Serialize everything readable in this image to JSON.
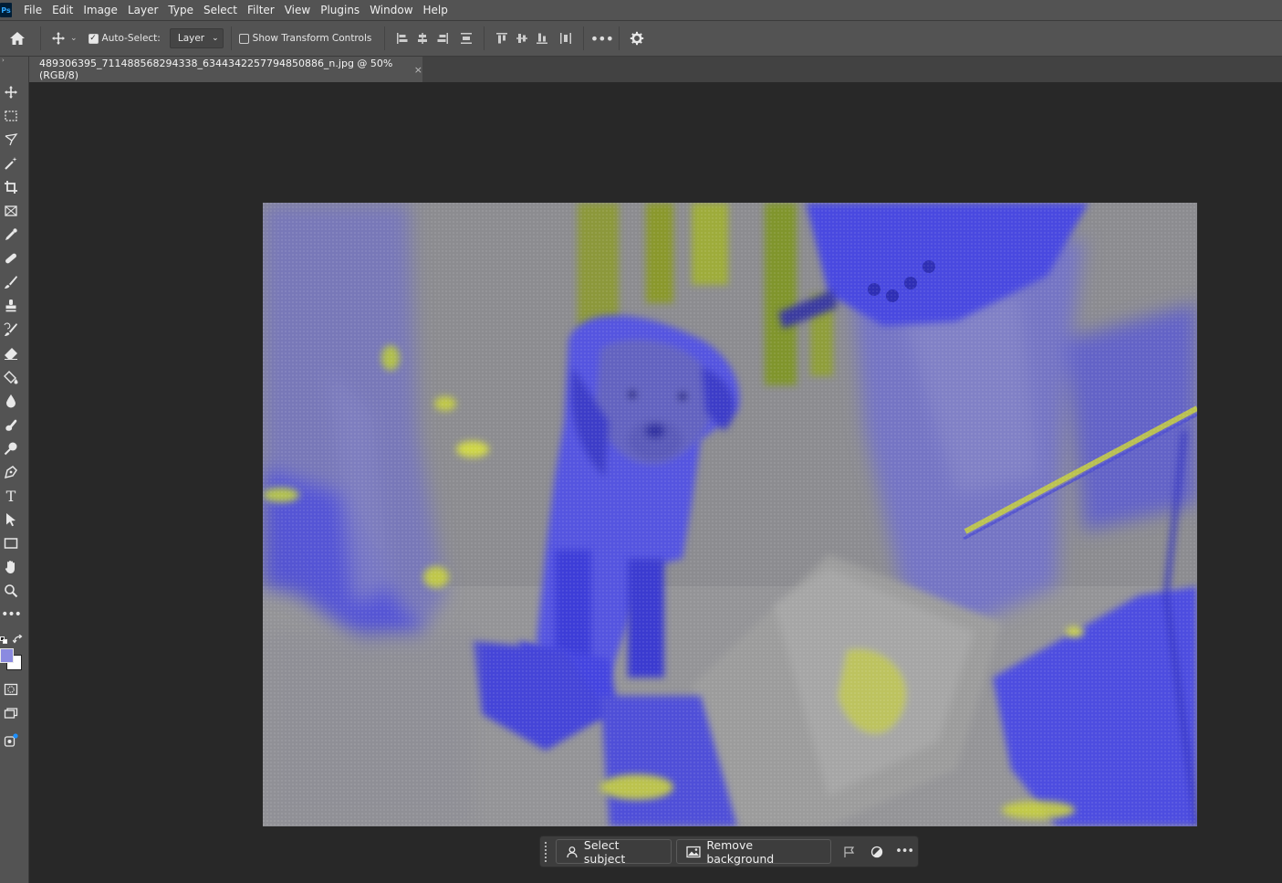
{
  "menu": [
    "File",
    "Edit",
    "Image",
    "Layer",
    "Type",
    "Select",
    "Filter",
    "View",
    "Plugins",
    "Window",
    "Help"
  ],
  "app_logo": "Ps",
  "options": {
    "auto_select_label": "Auto-Select:",
    "auto_select_checked": true,
    "auto_select_target": "Layer",
    "transform_controls_label": "Show Transform Controls",
    "transform_controls_checked": false
  },
  "document_tab": {
    "title": "489306395_711488568294338_6344342257794850886_n.jpg @ 50% (RGB/8)",
    "close": "×"
  },
  "tools": [
    "move",
    "marquee",
    "lasso",
    "magic-wand",
    "crop",
    "frame",
    "eyedropper",
    "healing",
    "brush",
    "stamp",
    "history-brush",
    "eraser",
    "paint-bucket",
    "blur",
    "smudge",
    "dodge",
    "pen",
    "type",
    "path-select",
    "rectangle",
    "hand",
    "zoom",
    "more"
  ],
  "colors": {
    "foreground": "#8a8ae0",
    "background": "#ffffff",
    "ui_panel": "#535353",
    "canvas_bg": "#282828",
    "image_tint": "#5050e0",
    "image_accent": "#c8d040"
  },
  "taskbar": {
    "select_subject": "Select subject",
    "remove_background": "Remove background"
  }
}
